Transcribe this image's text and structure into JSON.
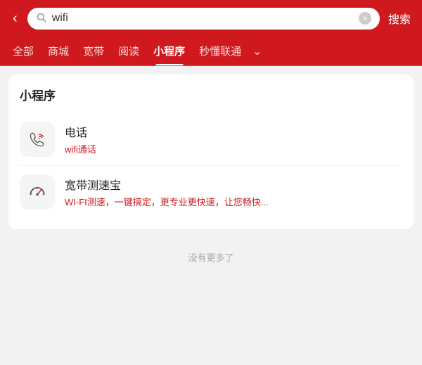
{
  "header": {
    "back_label": "‹",
    "search_value": "wifi",
    "search_placeholder": "搜索",
    "clear_btn_label": "×",
    "search_btn_label": "搜索"
  },
  "tabs": [
    {
      "id": "all",
      "label": "全部",
      "active": false
    },
    {
      "id": "mall",
      "label": "商城",
      "active": false
    },
    {
      "id": "broadband",
      "label": "宽带",
      "active": false
    },
    {
      "id": "reading",
      "label": "阅读",
      "active": false
    },
    {
      "id": "miniapp",
      "label": "小程序",
      "active": true
    },
    {
      "id": "understand",
      "label": "秒懂联通",
      "active": false
    }
  ],
  "section": {
    "title": "小程序",
    "items": [
      {
        "id": "phone",
        "name": "电话",
        "desc_prefix": "wifi",
        "desc_suffix": "通话",
        "icon_type": "phone-wifi"
      },
      {
        "id": "speedtest",
        "name": "宽带测速宝",
        "desc": "WI-FI测速，一键搞定，更专业更快速，让您畅快...",
        "icon_type": "speedometer"
      }
    ]
  },
  "footer": {
    "no_more_label": "没有更多了"
  }
}
